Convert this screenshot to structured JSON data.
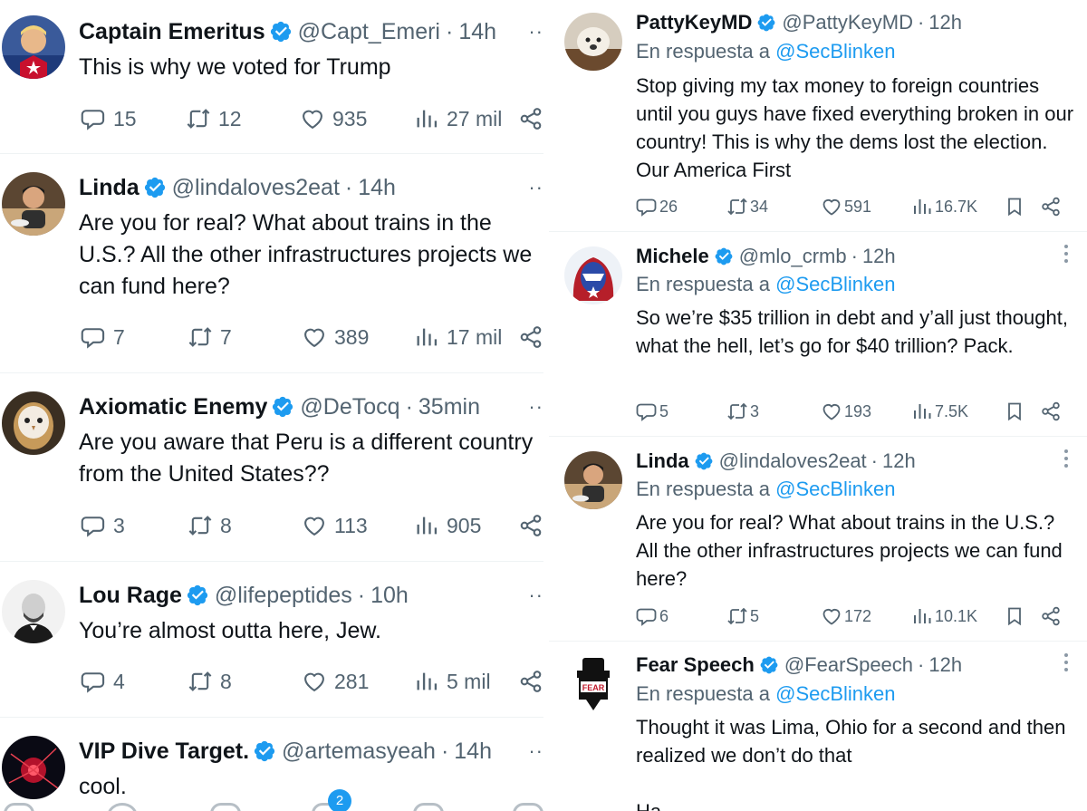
{
  "left_feed": {
    "tweets": [
      {
        "name": "Captain Emeritus",
        "handle": "@Capt_Emeri",
        "time": "14h",
        "text": "This is why we voted for Trump",
        "replies": "15",
        "reposts": "12",
        "likes": "935",
        "views": "27 mil"
      },
      {
        "name": "Linda",
        "handle": "@lindaloves2eat",
        "time": "14h",
        "text": "Are you for real? What about trains in the U.S.? All the other infrastructures projects we can fund here?",
        "replies": "7",
        "reposts": "7",
        "likes": "389",
        "views": "17 mil"
      },
      {
        "name": "Axiomatic Enemy",
        "handle": "@DeTocq",
        "time": "35min",
        "text": "Are you aware that Peru is a different country from the United States??",
        "replies": "3",
        "reposts": "8",
        "likes": "113",
        "views": "905"
      },
      {
        "name": "Lou Rage",
        "handle": "@lifepeptides",
        "time": "10h",
        "text": "You’re almost outta here, Jew.",
        "replies": "4",
        "reposts": "8",
        "likes": "281",
        "views": "5 mil"
      },
      {
        "name": "VIP Dive Target.",
        "handle": "@artemasyeah",
        "time": "14h",
        "text": "cool."
      }
    ],
    "nav_badge": "2"
  },
  "right_feed": {
    "reply_prefix": "En respuesta a",
    "tweets": [
      {
        "name": "PattyKeyMD",
        "handle": "@PattyKeyMD",
        "time": "12h",
        "reply_to": "@SecBlinken",
        "text": "Stop giving my tax money to foreign countries until you guys have fixed everything broken in our country! This is why the dems lost the election. Our America First",
        "replies": "26",
        "reposts": "34",
        "likes": "591",
        "views": "16.7K"
      },
      {
        "name": "Michele",
        "handle": "@mlo_crmb",
        "time": "12h",
        "reply_to": "@SecBlinken",
        "text": "So we’re $35 trillion in debt and y’all just thought, what the hell, let’s go for $40 trillion?  Pack.",
        "replies": "5",
        "reposts": "3",
        "likes": "193",
        "views": "7.5K"
      },
      {
        "name": "Linda",
        "handle": "@lindaloves2eat",
        "time": "12h",
        "reply_to": "@SecBlinken",
        "text": "Are you for real? What about trains in the U.S.? All the other infrastructures projects we can fund here?",
        "replies": "6",
        "reposts": "5",
        "likes": "172",
        "views": "10.1K"
      },
      {
        "name": "Fear Speech",
        "handle": "@FearSpeech",
        "time": "12h",
        "reply_to": "@SecBlinken",
        "text": "Thought it was Lima, Ohio for a second and then realized we don’t do that",
        "text2": "Ha",
        "avatar_label": "FEAR"
      }
    ]
  },
  "colors": {
    "verified_blue": "#1d9bf0",
    "secondary_text": "#536471",
    "primary_text": "#0f1419",
    "divider": "#eff3f4"
  },
  "icons": [
    "reply-icon",
    "repost-icon",
    "like-icon",
    "views-icon",
    "share-icon",
    "bookmark-icon",
    "verified-badge-icon",
    "more-icon"
  ]
}
